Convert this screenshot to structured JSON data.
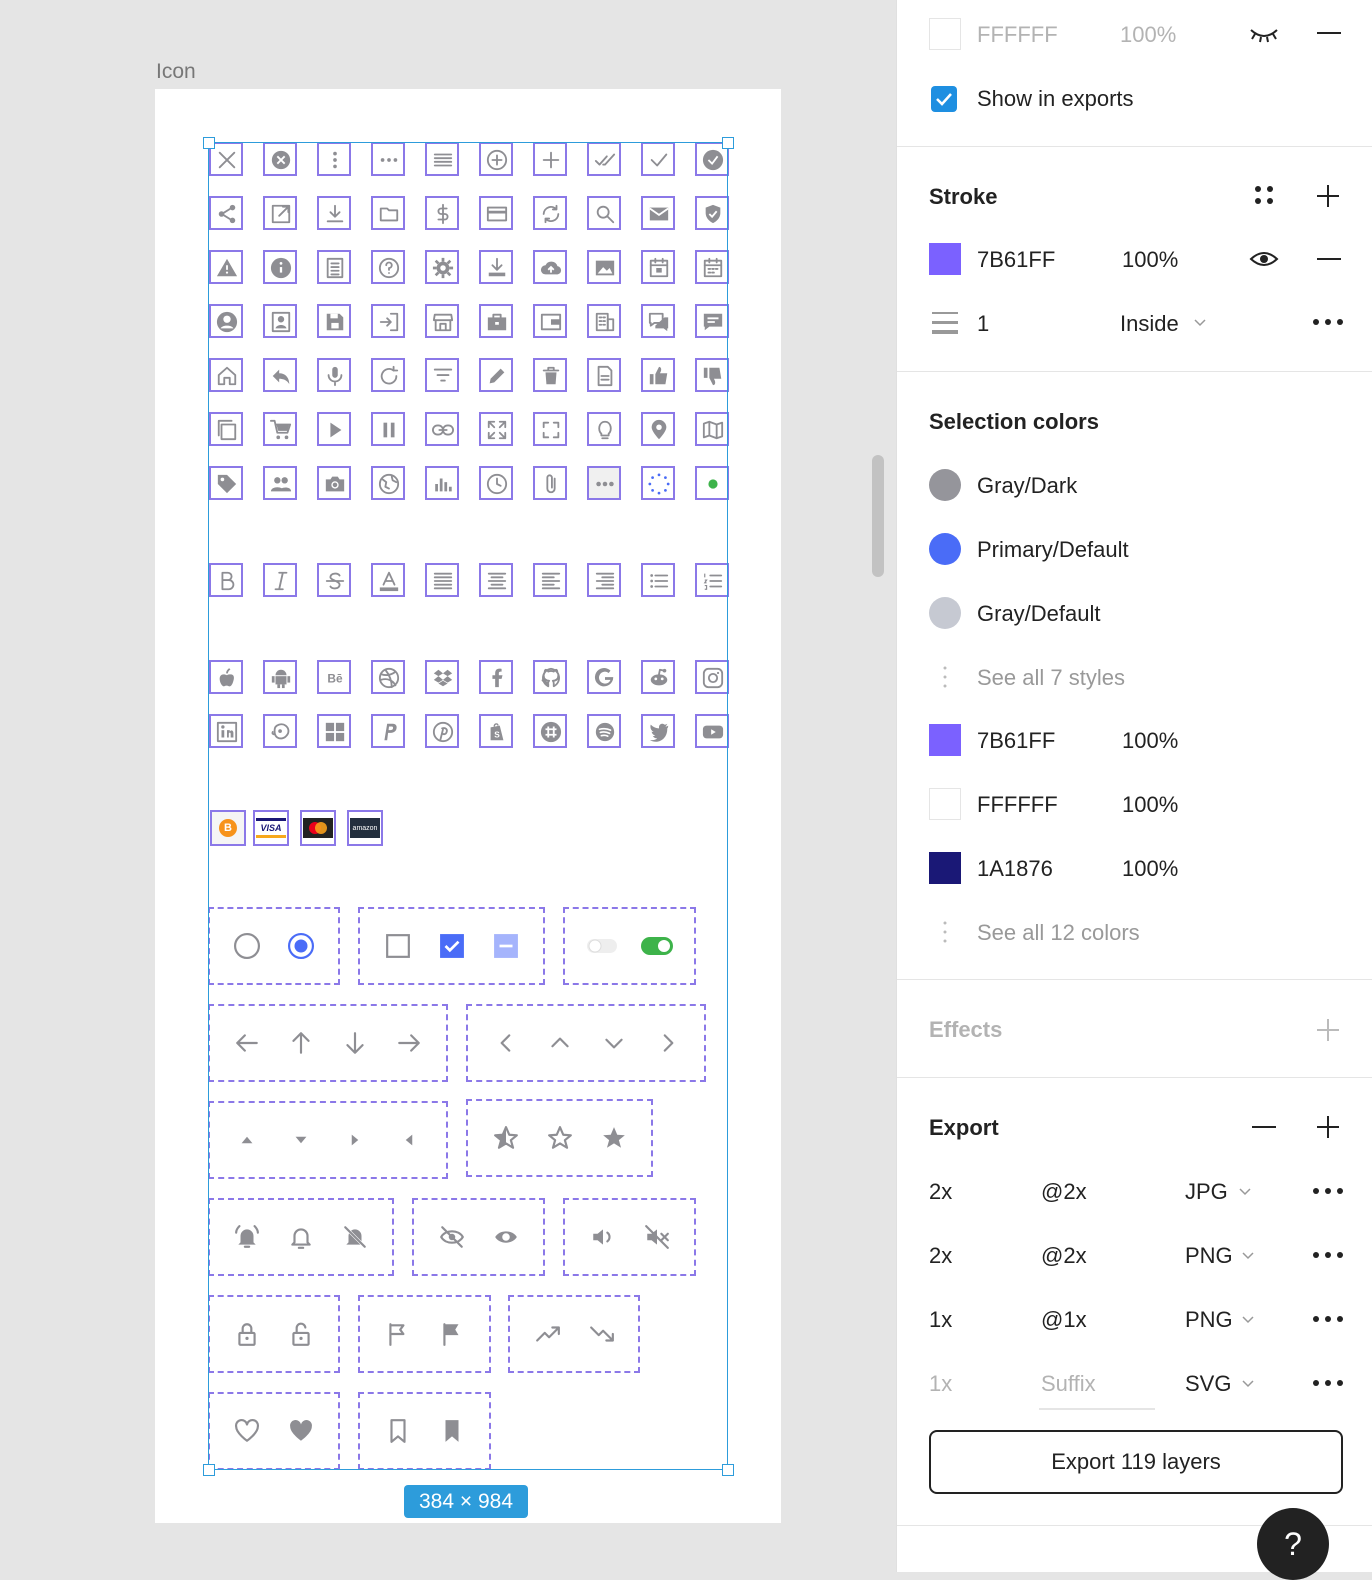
{
  "canvas": {
    "frame_label": "Icon",
    "size_badge": "384 × 984",
    "payment_badges": [
      "B",
      "VISA",
      "",
      "amazon"
    ]
  },
  "panel": {
    "fill": {
      "hex": "FFFFFF",
      "opacity": "100%",
      "show_in_exports": "Show in exports"
    },
    "stroke": {
      "title": "Stroke",
      "hex": "7B61FF",
      "opacity": "100%",
      "weight": "1",
      "position": "Inside"
    },
    "selection_colors": {
      "title": "Selection colors",
      "styles": [
        {
          "name": "Gray/Dark",
          "color": "#95959b"
        },
        {
          "name": "Primary/Default",
          "color": "#4a6cf7"
        },
        {
          "name": "Gray/Default",
          "color": "#c6c9d2"
        }
      ],
      "see_all_styles": "See all 7 styles",
      "colors": [
        {
          "hex": "7B61FF",
          "opacity": "100%",
          "color": "#7b61ff"
        },
        {
          "hex": "FFFFFF",
          "opacity": "100%",
          "color": "#ffffff"
        },
        {
          "hex": "1A1876",
          "opacity": "100%",
          "color": "#1a1876"
        }
      ],
      "see_all_colors": "See all 12 colors"
    },
    "effects": {
      "title": "Effects"
    },
    "export": {
      "title": "Export",
      "rows": [
        {
          "scale": "2x",
          "suffix": "@2x",
          "format": "JPG"
        },
        {
          "scale": "2x",
          "suffix": "@2x",
          "format": "PNG"
        },
        {
          "scale": "1x",
          "suffix": "@1x",
          "format": "PNG"
        },
        {
          "scale": "1x",
          "suffix": "Suffix",
          "format": "SVG"
        }
      ],
      "button": "Export 119 layers"
    },
    "help": "?"
  }
}
